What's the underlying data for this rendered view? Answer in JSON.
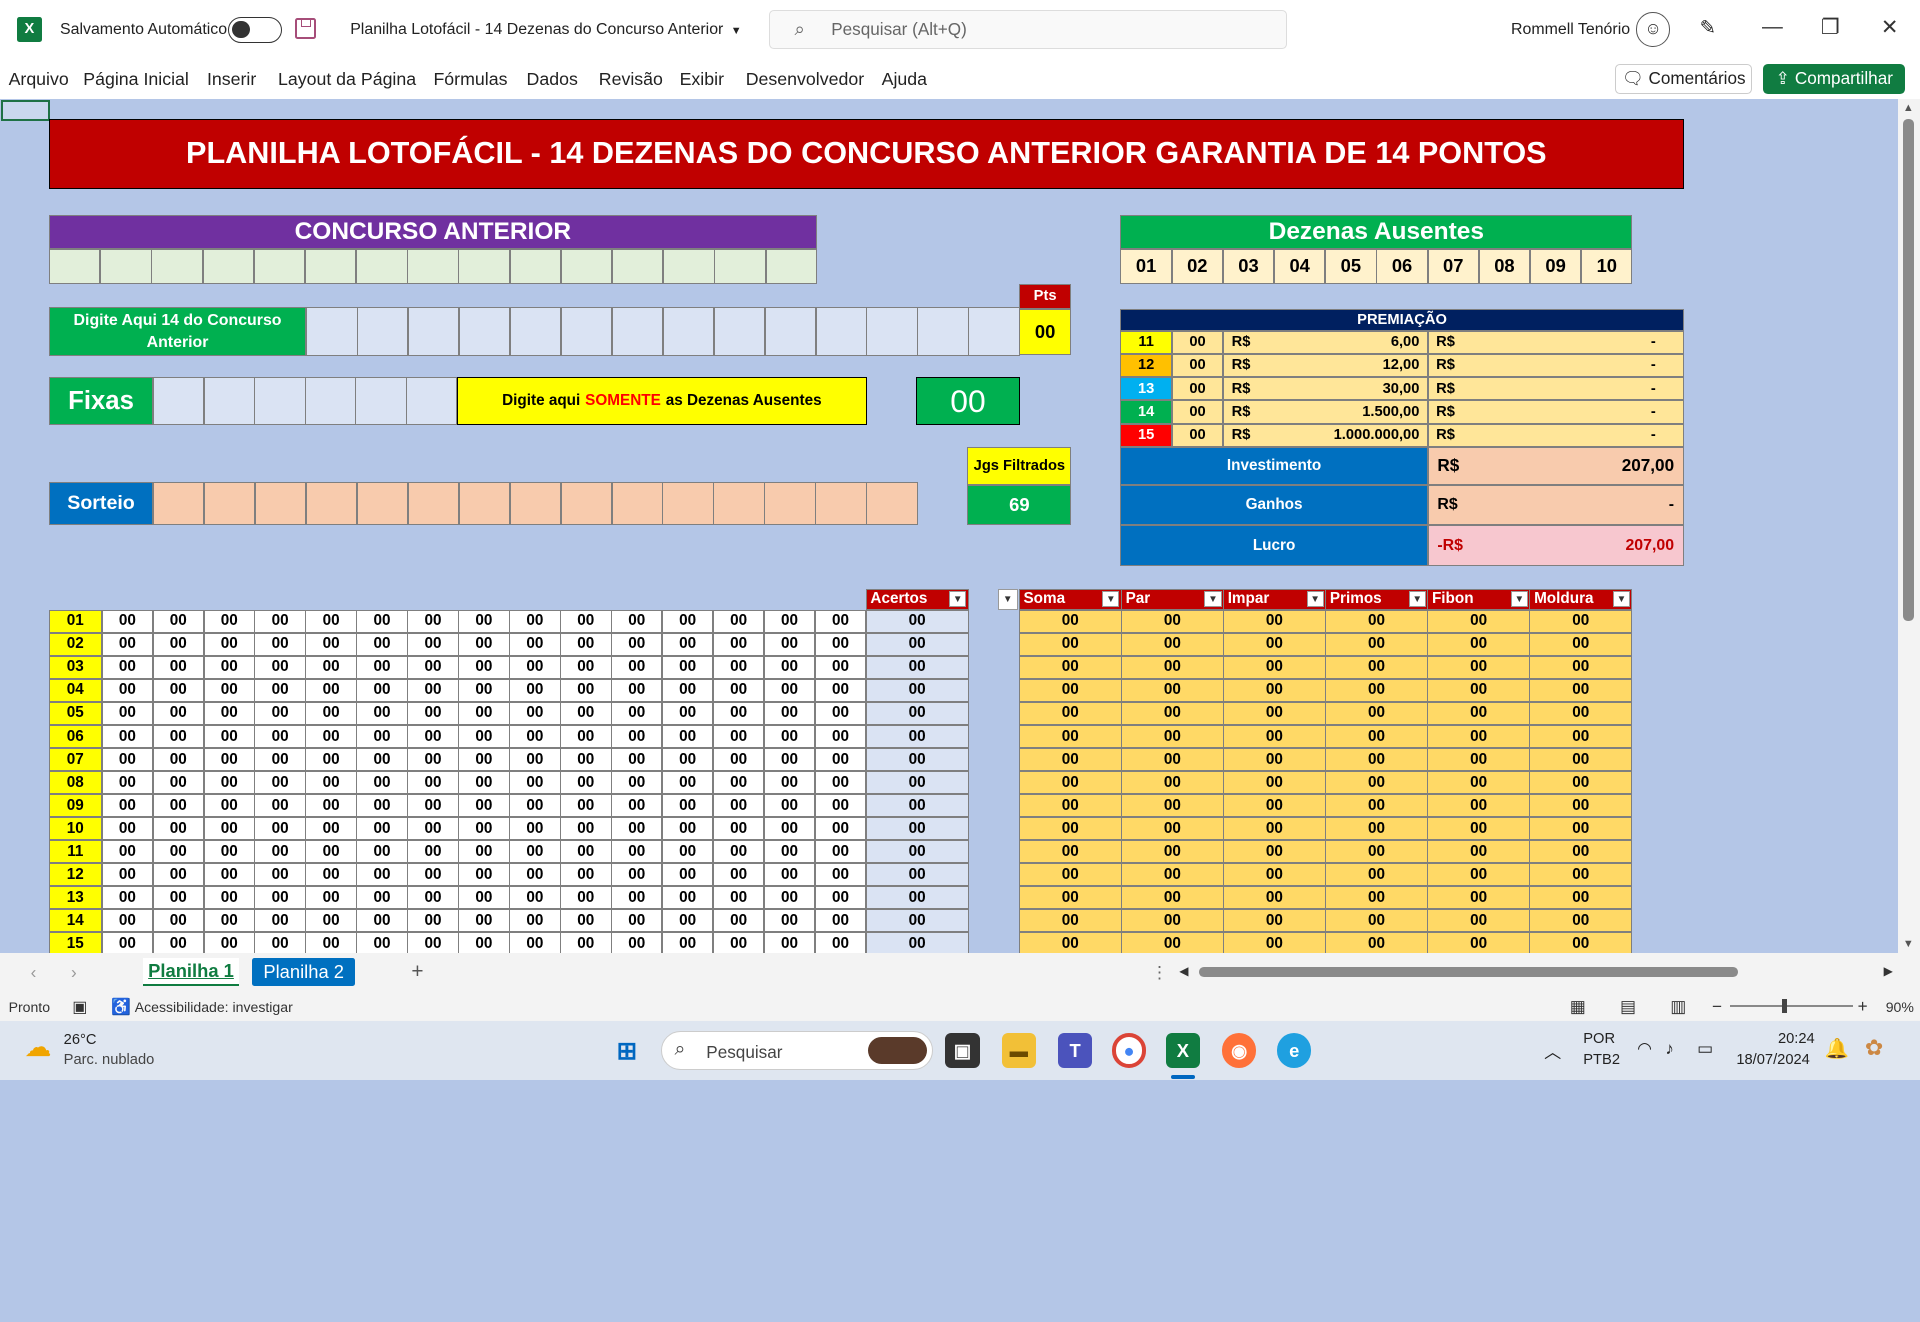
{
  "app": {
    "logo": "X",
    "autosave_label": "Salvamento Automático",
    "doc_title": "Planilha Lotofácil - 14 Dezenas do Concurso Anterior",
    "search_placeholder": "Pesquisar (Alt+Q)",
    "user_name": "Rommell Tenório"
  },
  "menu": {
    "items": [
      "Arquivo",
      "Página Inicial",
      "Inserir",
      "Layout da Página",
      "Fórmulas",
      "Dados",
      "Revisão",
      "Exibir",
      "Desenvolvedor",
      "Ajuda"
    ],
    "comments_label": "Comentários",
    "share_label": "Compartilhar"
  },
  "sheet": {
    "banner": "PLANILHA LOTOFÁCIL - 14 DEZENAS DO CONCURSO ANTERIOR GARANTIA DE 14 PONTOS",
    "concurso_anterior": "CONCURSO ANTERIOR",
    "dezenas_ausentes": "Dezenas Ausentes",
    "ausentes_numbers": [
      "01",
      "02",
      "03",
      "04",
      "05",
      "06",
      "07",
      "08",
      "09",
      "10"
    ],
    "digite_label": "Digite Aqui 14 do Concurso Anterior",
    "pts_header": "Pts",
    "pts_value": "00",
    "fixas_label": "Fixas",
    "msg_prefix": "Digite aqui",
    "msg_highlight": "SOMENTE",
    "msg_suffix": "as Dezenas Ausentes",
    "fixas_count": "00",
    "sorteio_label": "Sorteio",
    "jgs_header": "Jgs Filtrados",
    "jgs_value": "69",
    "premiacao_header": "PREMIAÇÃO",
    "premiacao_rows": [
      {
        "pontos": "11",
        "color": "#ffff00",
        "text_color": "#000000",
        "acertos": "00",
        "cur1": "R$",
        "valor": "6,00",
        "cur2": "R$",
        "total": "-"
      },
      {
        "pontos": "12",
        "color": "#ffc000",
        "text_color": "#000000",
        "acertos": "00",
        "cur1": "R$",
        "valor": "12,00",
        "cur2": "R$",
        "total": "-"
      },
      {
        "pontos": "13",
        "color": "#00b0f0",
        "text_color": "#ffffff",
        "acertos": "00",
        "cur1": "R$",
        "valor": "30,00",
        "cur2": "R$",
        "total": "-"
      },
      {
        "pontos": "14",
        "color": "#00b050",
        "text_color": "#ffffff",
        "acertos": "00",
        "cur1": "R$",
        "valor": "1.500,00",
        "cur2": "R$",
        "total": "-"
      },
      {
        "pontos": "15",
        "color": "#ff0000",
        "text_color": "#ffffff",
        "acertos": "00",
        "cur1": "R$",
        "valor": "1.000.000,00",
        "cur2": "R$",
        "total": "-"
      }
    ],
    "investimento_label": "Investimento",
    "investimento_cur": "R$",
    "investimento_value": "207,00",
    "ganhos_label": "Ganhos",
    "ganhos_cur": "R$",
    "ganhos_value": "-",
    "lucro_label": "Lucro",
    "lucro_cur": "-R$",
    "lucro_value": "207,00",
    "acertos_header": "Acertos",
    "stats_headers": [
      "Soma",
      "Par",
      "Impar",
      "Primos",
      "Fibon",
      "Moldura"
    ],
    "row_ids": [
      "01",
      "02",
      "03",
      "04",
      "05",
      "06",
      "07",
      "08",
      "09",
      "10",
      "11",
      "12",
      "13",
      "14",
      "15"
    ],
    "cell_value": "00"
  },
  "tabs": {
    "sheet1": "Planilha 1",
    "sheet2": "Planilha 2",
    "add": "+"
  },
  "status": {
    "ready": "Pronto",
    "accessibility": "Acessibilidade: investigar",
    "zoom": "90%"
  },
  "taskbar": {
    "temp": "26°C",
    "weather": "Parc. nublado",
    "search": "Pesquisar",
    "lang1": "POR",
    "lang2": "PTB2",
    "time": "20:24",
    "date": "18/07/2024"
  },
  "colors": {
    "excel_green": "#107c41",
    "banner_red": "#c00000",
    "sheet_bg": "#b4c6e7",
    "row_yellow": "#ffff00",
    "stats_gold": "#ffd966",
    "acertos_bg": "#dae3f3"
  }
}
